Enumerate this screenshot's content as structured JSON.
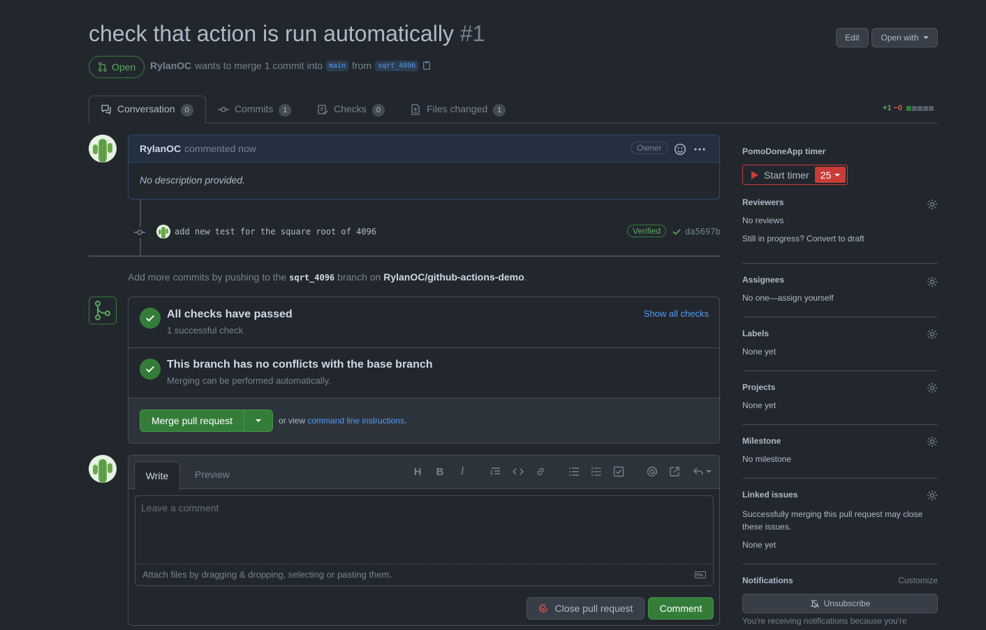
{
  "pr": {
    "title": "check that action is run automatically",
    "number": "#1",
    "state": "Open",
    "author": "RylanOC",
    "merge_text": "wants to merge 1 commit into",
    "base_branch": "main",
    "from_text": "from",
    "head_branch": "sqrt_4096"
  },
  "header_actions": {
    "edit": "Edit",
    "open_with": "Open with"
  },
  "tabs": [
    {
      "label": "Conversation",
      "count": "0"
    },
    {
      "label": "Commits",
      "count": "1"
    },
    {
      "label": "Checks",
      "count": "0"
    },
    {
      "label": "Files changed",
      "count": "1"
    }
  ],
  "diffstat": {
    "added": "+1",
    "removed": "−0"
  },
  "comment": {
    "author": "RylanOC",
    "meta": "commented now",
    "badge": "Owner",
    "body": "No description provided."
  },
  "commit": {
    "message": "add new test for the square root of 4096",
    "verified": "Verified",
    "sha": "da5697b"
  },
  "push_hint": {
    "prefix": "Add more commits by pushing to the",
    "branch": "sqrt_4096",
    "middle": "branch on",
    "repo": "RylanOC/github-actions-demo",
    "suffix": "."
  },
  "checks": {
    "title": "All checks have passed",
    "subtitle": "1 successful check",
    "show_all": "Show all checks",
    "conflicts_title": "This branch has no conflicts with the base branch",
    "conflicts_subtitle": "Merging can be performed automatically.",
    "merge_button": "Merge pull request",
    "or_view": "or view",
    "cli_link": "command line instructions",
    "cli_suffix": "."
  },
  "editor": {
    "tab_write": "Write",
    "tab_preview": "Preview",
    "placeholder": "Leave a comment",
    "attach_hint": "Attach files by dragging & dropping, selecting or pasting them.",
    "close_button": "Close pull request",
    "comment_button": "Comment"
  },
  "sidebar": {
    "pomo_title": "PomoDoneApp timer",
    "start_timer": "Start timer",
    "timer_value": "25",
    "reviewers_title": "Reviewers",
    "reviewers_value": "No reviews",
    "reviewers_hint": "Still in progress? Convert to draft",
    "assignees_title": "Assignees",
    "assignees_value": "No one—assign yourself",
    "labels_title": "Labels",
    "labels_value": "None yet",
    "projects_title": "Projects",
    "projects_value": "None yet",
    "milestone_title": "Milestone",
    "milestone_value": "No milestone",
    "linked_title": "Linked issues",
    "linked_desc": "Successfully merging this pull request may close these issues.",
    "linked_value": "None yet",
    "notifications_title": "Notifications",
    "customize": "Customize",
    "unsubscribe": "Unsubscribe",
    "notif_reason": "You're receiving notifications because you're"
  },
  "colors": {
    "bg": "#22272e",
    "accent_green": "#347d39",
    "link_blue": "#539bf5",
    "danger_red": "#e5534b"
  }
}
